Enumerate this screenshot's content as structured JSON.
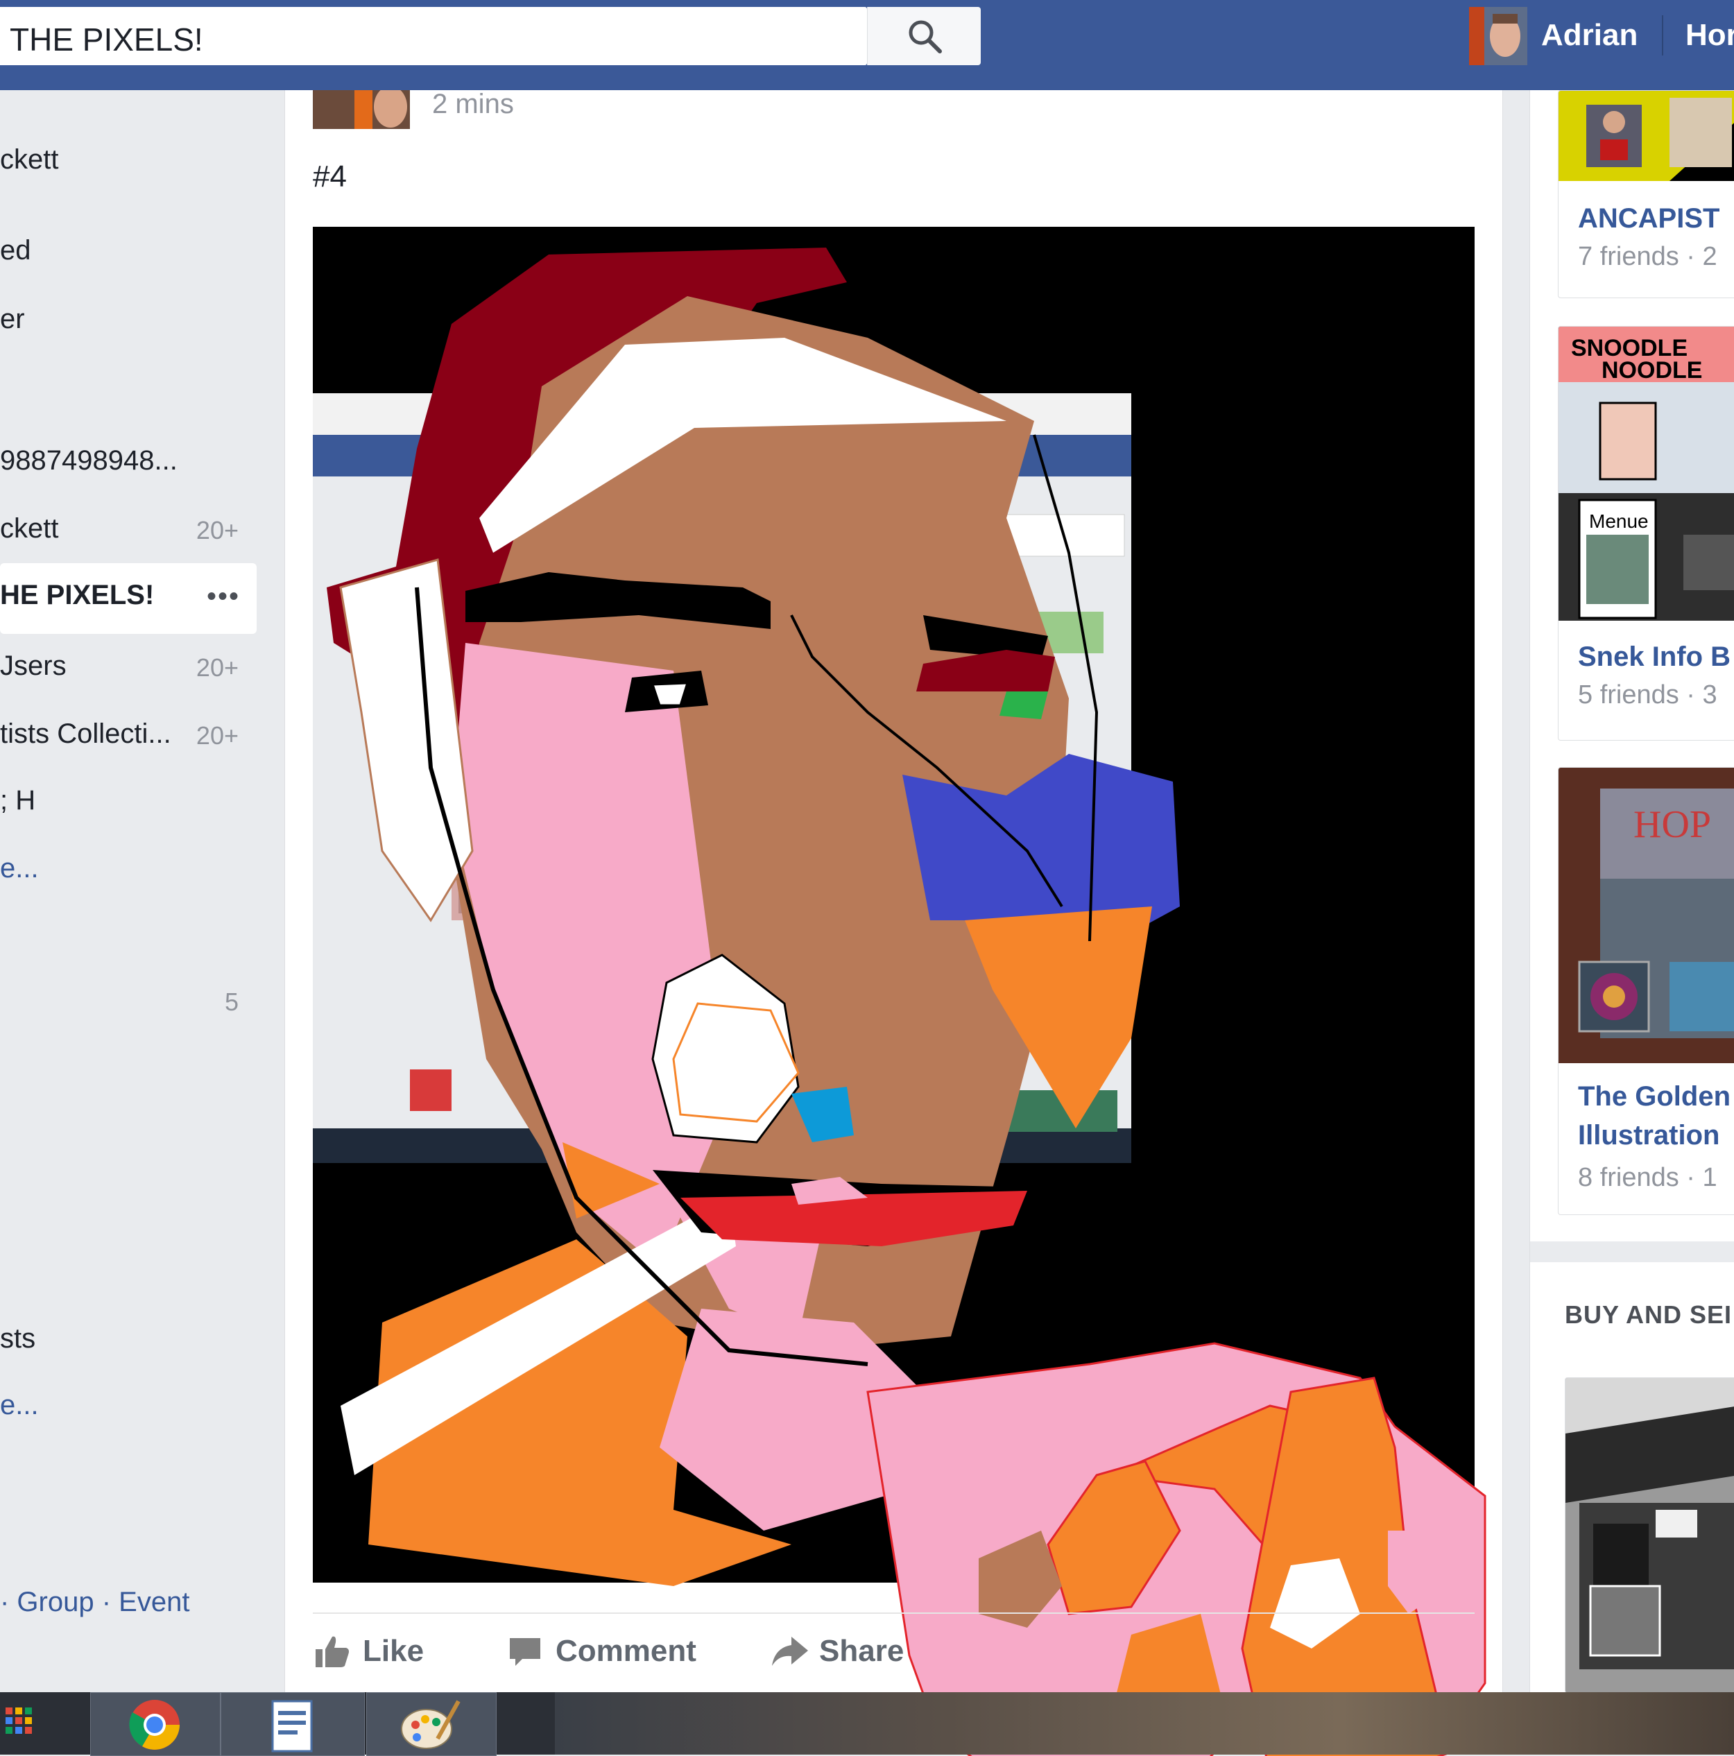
{
  "topbar": {
    "search_value": "THE PIXELS!",
    "user_name": "Adrian",
    "home_label": "Hor",
    "search_icon": "magnifier-icon"
  },
  "leftnav": {
    "items": [
      {
        "label": "ckett",
        "count": ""
      },
      {
        "label": "ed",
        "count": ""
      },
      {
        "label": "er",
        "count": ""
      },
      {
        "label": "9887498948...",
        "count": ""
      },
      {
        "label": "ckett",
        "count": "20+"
      },
      {
        "label": "HE PIXELS!",
        "count": "",
        "active": true
      },
      {
        "label": "Jsers",
        "count": "20+"
      },
      {
        "label": "tists Collecti...",
        "count": "20+"
      },
      {
        "label": "; H",
        "count": ""
      },
      {
        "label": "e...",
        "count": ""
      },
      {
        "label": "",
        "count": "5"
      },
      {
        "label": "sts",
        "count": ""
      },
      {
        "label": "e...",
        "count": ""
      }
    ],
    "active_dots": "•••",
    "footer": "· Group · Event"
  },
  "post": {
    "time": "2 mins",
    "text": "#4",
    "actions": {
      "like": "Like",
      "comment": "Comment",
      "share": "Share"
    }
  },
  "rightcol": {
    "suggestions": [
      {
        "title": "ANCAPIST",
        "sub": "7 friends · 2"
      },
      {
        "title": "Snek Info B",
        "sub": "5 friends · 3"
      },
      {
        "title_line1": "The Golden",
        "title_line2": "Illustration",
        "sub": "8 friends · 1"
      }
    ],
    "snoodle_line1": "SNOODLE",
    "snoodle_line2": "NOODLE",
    "menue": "Menue",
    "section_head": "BUY AND SEI"
  },
  "colors": {
    "facebook_blue": "#3b5998",
    "link_blue": "#365899",
    "art_dark_red": "#8a0016",
    "art_brown": "#b87a58",
    "art_pink": "#f7aac8",
    "art_orange": "#f6852a",
    "art_blue": "#4049c8",
    "art_red": "#e3242b",
    "art_cyan": "#0d9ad8"
  }
}
